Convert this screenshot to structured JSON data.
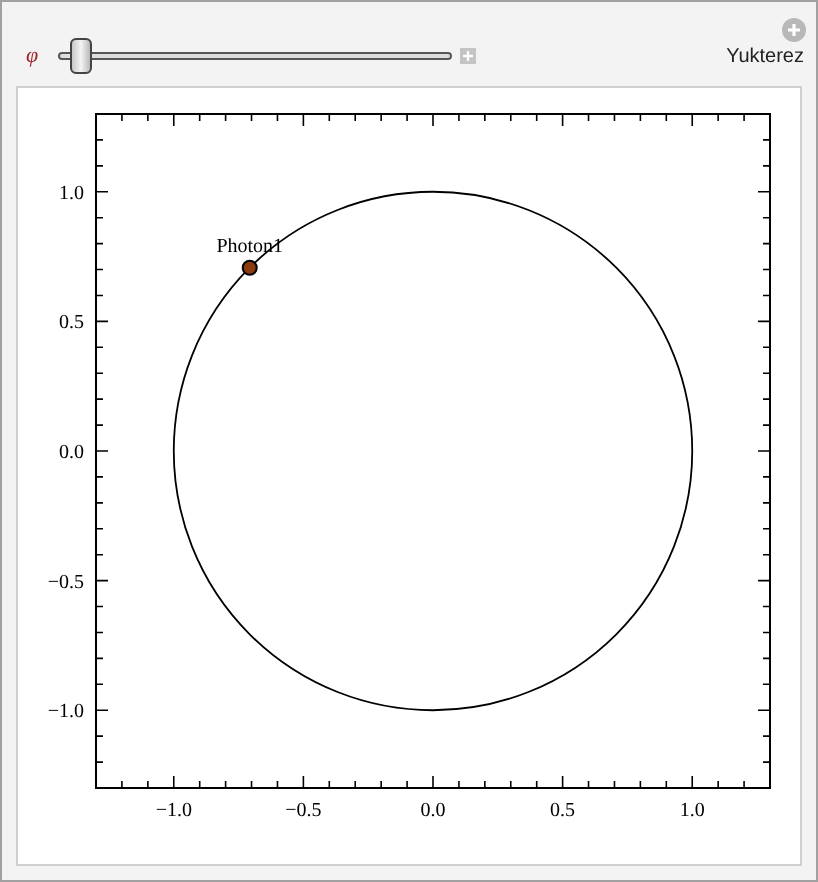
{
  "control": {
    "label": "φ",
    "level": 0.03
  },
  "output_label": "Yukterez",
  "plot": {
    "chart_data": {
      "type": "scatter",
      "xlim": [
        -1.3,
        1.3
      ],
      "ylim": [
        -1.3,
        1.3
      ],
      "xticks": [
        {
          "value": -1,
          "label": "−1.0"
        },
        {
          "value": -0.5,
          "label": "−0.5"
        },
        {
          "value": 0,
          "label": "0.0"
        },
        {
          "value": 0.5,
          "label": "0.5"
        },
        {
          "value": 1,
          "label": "1.0"
        }
      ],
      "yticks": [
        {
          "value": -1,
          "label": "−1.0"
        },
        {
          "value": -0.5,
          "label": "−0.5"
        },
        {
          "value": 0,
          "label": "0.0"
        },
        {
          "value": 0.5,
          "label": "0.5"
        },
        {
          "value": 1,
          "label": "1.0"
        }
      ],
      "x": [
        -0.707
      ],
      "series": [
        {
          "name": "Photon1",
          "color": "#8b3a0f",
          "values": [
            0.707
          ]
        }
      ]
    }
  }
}
